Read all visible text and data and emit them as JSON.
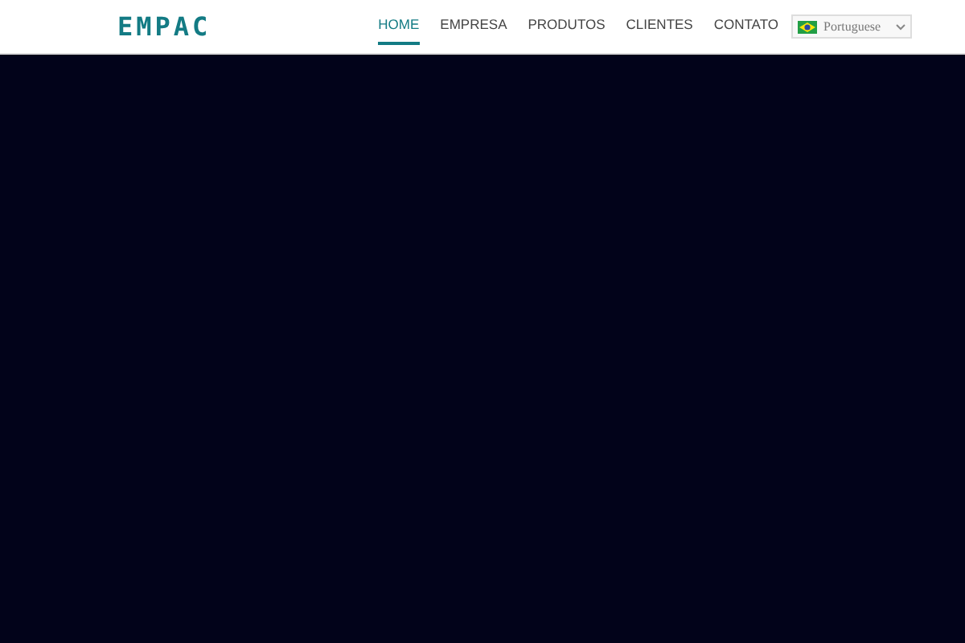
{
  "logo": "EMPAC",
  "nav": [
    {
      "label": "HOME",
      "selected": true
    },
    {
      "label": "EMPRESA",
      "selected": false
    },
    {
      "label": "PRODUTOS",
      "selected": false
    },
    {
      "label": "CLIENTES",
      "selected": false
    },
    {
      "label": "CONTATO",
      "selected": false
    }
  ],
  "language": {
    "value": "Portuguese"
  }
}
